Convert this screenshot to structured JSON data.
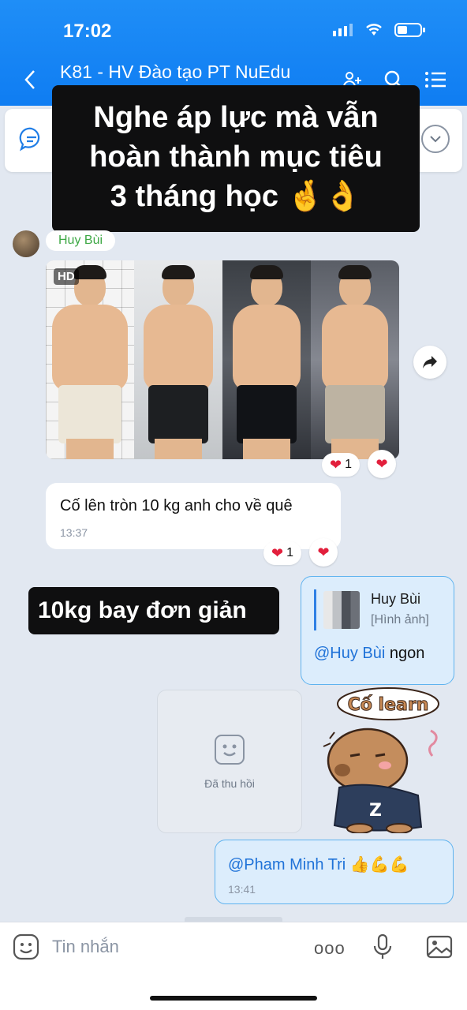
{
  "status_bar": {
    "time": "17:02"
  },
  "header": {
    "title": "K81 - HV Đào tạo PT NuEdu"
  },
  "overlay": {
    "top_line1": "Nghe áp lực mà vẫn",
    "top_line2": "hoàn thành mục tiêu",
    "top_line3": "3 tháng học 🤞👌",
    "mid": "10kg bay đơn giản"
  },
  "messages": {
    "sender": "Huy Bùi",
    "photo": {
      "badge": "HD",
      "react_count": "1"
    },
    "text1": {
      "body": "Cố lên tròn 10 kg anh cho về quê",
      "time": "13:37",
      "react_count": "1"
    },
    "reply": {
      "quoted_name": "Huy Bùi",
      "quoted_type": "[Hình ảnh]",
      "mention": "@Huy Bùi",
      "text": " ngon"
    },
    "recalled": {
      "label": "Đã thu hồi"
    },
    "last": {
      "mention": "@Pham Minh Tri",
      "emoji": " 👍💪💪",
      "time": "13:41"
    }
  },
  "input": {
    "placeholder": "Tin nhắn",
    "more": "ooo"
  },
  "colors": {
    "header_bg": "#0f7df2",
    "bubble_out": "#dcedfc",
    "sender_name": "#3ea845",
    "mention": "#1f72d8"
  }
}
